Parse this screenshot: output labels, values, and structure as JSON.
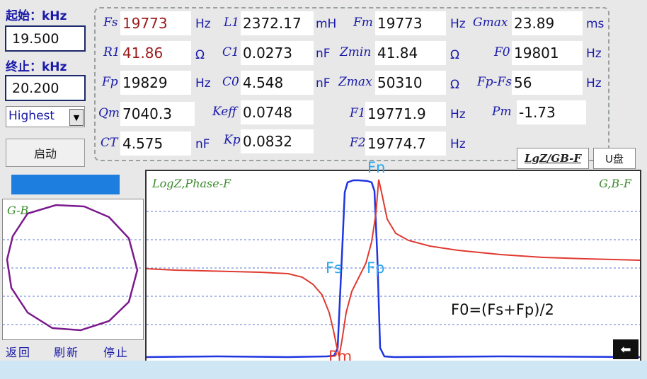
{
  "sweep": {
    "start_label": "起始：kHz",
    "start_value": "19.500",
    "stop_label": "终止：kHz",
    "stop_value": "20.200",
    "level_selected": "Highest",
    "start_button": "启动"
  },
  "params": {
    "fs_label": "Fs",
    "fs_value": "19773",
    "fs_unit": "Hz",
    "l1_label": "L1",
    "l1_value": "2372.17",
    "l1_unit": "mH",
    "fm_label": "Fm",
    "fm_value": "19773",
    "fm_unit": "Hz",
    "gmax_label": "Gmax",
    "gmax_value": "23.89",
    "gmax_unit": "ms",
    "r1_label": "R1",
    "r1_value": "41.86",
    "r1_unit": "Ω",
    "c1_label": "C1",
    "c1_value": "0.0273",
    "c1_unit": "nF",
    "zmin_label": "Zmin",
    "zmin_value": "41.84",
    "zmin_unit": "Ω",
    "f0_label": "F0",
    "f0_value": "19801",
    "f0_unit": "Hz",
    "fp_label": "Fp",
    "fp_value": "19829",
    "fp_unit": "Hz",
    "c0_label": "C0",
    "c0_value": "4.548",
    "c0_unit": "nF",
    "zmax_label": "Zmax",
    "zmax_value": "50310",
    "zmax_unit": "Ω",
    "fpfs_label": "Fp-Fs",
    "fpfs_value": "56",
    "fpfs_unit": "Hz",
    "qm_label": "Qm",
    "qm_value": "7040.3",
    "keff_label": "Keff",
    "keff_value": "0.0748",
    "f1_label": "F1",
    "f1_value": "19771.9",
    "f1_unit": "Hz",
    "pm_label": "Pm",
    "pm_value": "-1.73",
    "ct_label": "CT",
    "ct_value": "4.575",
    "ct_unit": "nF",
    "kp_label": "Kp",
    "kp_value": "0.0832",
    "f2_label": "F2",
    "f2_value": "19774.7",
    "f2_unit": "Hz"
  },
  "tabs": {
    "lgz": "LgZ/GB-F",
    "udisk": "U盘"
  },
  "gb_panel": {
    "title": "G-B"
  },
  "chart": {
    "left_title": "LogZ,Phase-F",
    "right_title": "G,B-F",
    "marker_fn": "Fn",
    "marker_fs": "Fs",
    "marker_fp": "Fp",
    "marker_pm": "Pm",
    "formula": "F0=(Fs+Fp)/2"
  },
  "bottom": {
    "back": "返回",
    "refresh": "刷新",
    "stop": "停止"
  },
  "colors": {
    "label_blue": "#1a1aa8",
    "value_red": "#9a1a1a",
    "progress_blue": "#1e7ee0",
    "blue_curve": "#1f35e0",
    "red_curve": "#e03a30",
    "circle_purple": "#7a1a8c",
    "title_green": "#3a8a2a",
    "annotation_blue": "#29a6ee",
    "annotation_red": "#e53a2a"
  },
  "icons": {
    "dropdown": "chevron-down-icon",
    "back_arrow": "left-arrow-icon"
  }
}
